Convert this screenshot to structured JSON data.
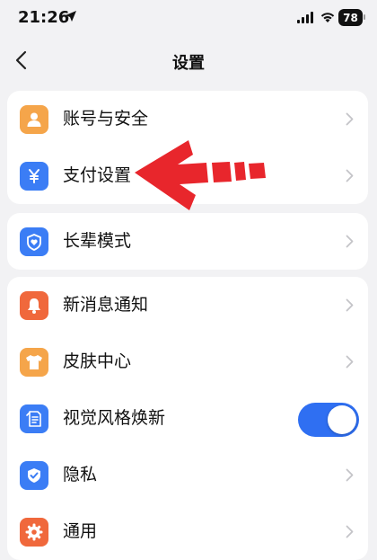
{
  "status_bar": {
    "time": "21:26",
    "battery": "78"
  },
  "nav": {
    "title": "设置"
  },
  "groups": [
    {
      "items": [
        {
          "label": "账号与安全",
          "icon": "person-icon",
          "color": "#f5a54a"
        },
        {
          "label": "支付设置",
          "icon": "yen-icon",
          "color": "#3b7df5"
        }
      ]
    },
    {
      "items": [
        {
          "label": "长辈模式",
          "icon": "heart-icon",
          "color": "#3b7df5"
        }
      ]
    },
    {
      "items": [
        {
          "label": "新消息通知",
          "icon": "bell-icon",
          "color": "#f0683c"
        },
        {
          "label": "皮肤中心",
          "icon": "shirt-icon",
          "color": "#f5a54a"
        },
        {
          "label": "视觉风格焕新",
          "icon": "calendar-new-icon",
          "color": "#3b7df5",
          "toggle": true,
          "toggle_on": true
        },
        {
          "label": "隐私",
          "icon": "shield-check-icon",
          "color": "#3b7df5"
        },
        {
          "label": "通用",
          "icon": "gear-icon",
          "color": "#f0683c"
        }
      ]
    }
  ],
  "annotation": {
    "arrow_color": "#e8262c"
  },
  "colors": {
    "background": "#f2f2f4",
    "toggle_on": "#2f6ff2"
  }
}
